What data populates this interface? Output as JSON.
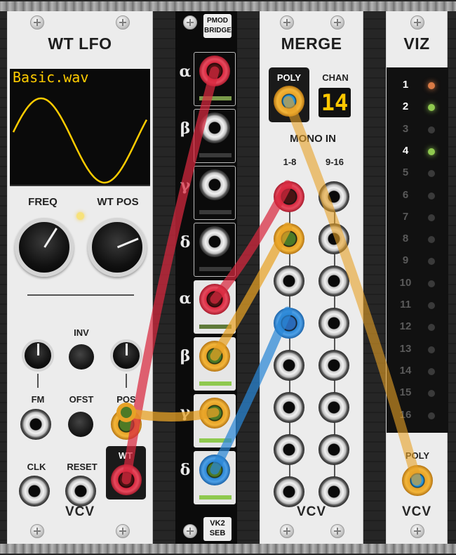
{
  "colors": {
    "cable_red": "#d8283f",
    "cable_yellow": "#e7a226",
    "cable_blue": "#2a86d6",
    "screen_yellow": "#ffcc00",
    "led_orange": "#d97a45",
    "led_green": "#8fc94f"
  },
  "wtlfo": {
    "title": "WT LFO",
    "display_text": "Basic.wav",
    "labels": {
      "freq": "FREQ",
      "wtpos": "WT POS",
      "inv": "INV",
      "fm": "FM",
      "ofst": "OFST",
      "pos": "POS",
      "clk": "CLK",
      "reset": "RESET",
      "wt": "WT"
    },
    "knob_values": {
      "freq": 0.62,
      "wt_pos": 0.75,
      "fm": 0.5,
      "pos": 0.5
    },
    "logo": "VCV"
  },
  "pmod": {
    "header": [
      "PMOD",
      "BRIDGE"
    ],
    "footer": [
      "VK2",
      "SEB"
    ],
    "top_labels": [
      "α",
      "β",
      "γ",
      "δ"
    ],
    "bottom_labels": [
      "α",
      "β",
      "γ",
      "δ"
    ]
  },
  "merge": {
    "title": "MERGE",
    "poly_label": "POLY",
    "chan_label": "CHAN",
    "chan_value": "14",
    "mono_in_label": "MONO IN",
    "col_labels": [
      "1-8",
      "9-16"
    ],
    "logo": "VCV"
  },
  "viz": {
    "title": "VIZ",
    "channels": [
      "1",
      "2",
      "3",
      "4",
      "5",
      "6",
      "7",
      "8",
      "9",
      "10",
      "11",
      "12",
      "13",
      "14",
      "15",
      "16"
    ],
    "poly_label": "POLY",
    "logo": "VCV"
  }
}
